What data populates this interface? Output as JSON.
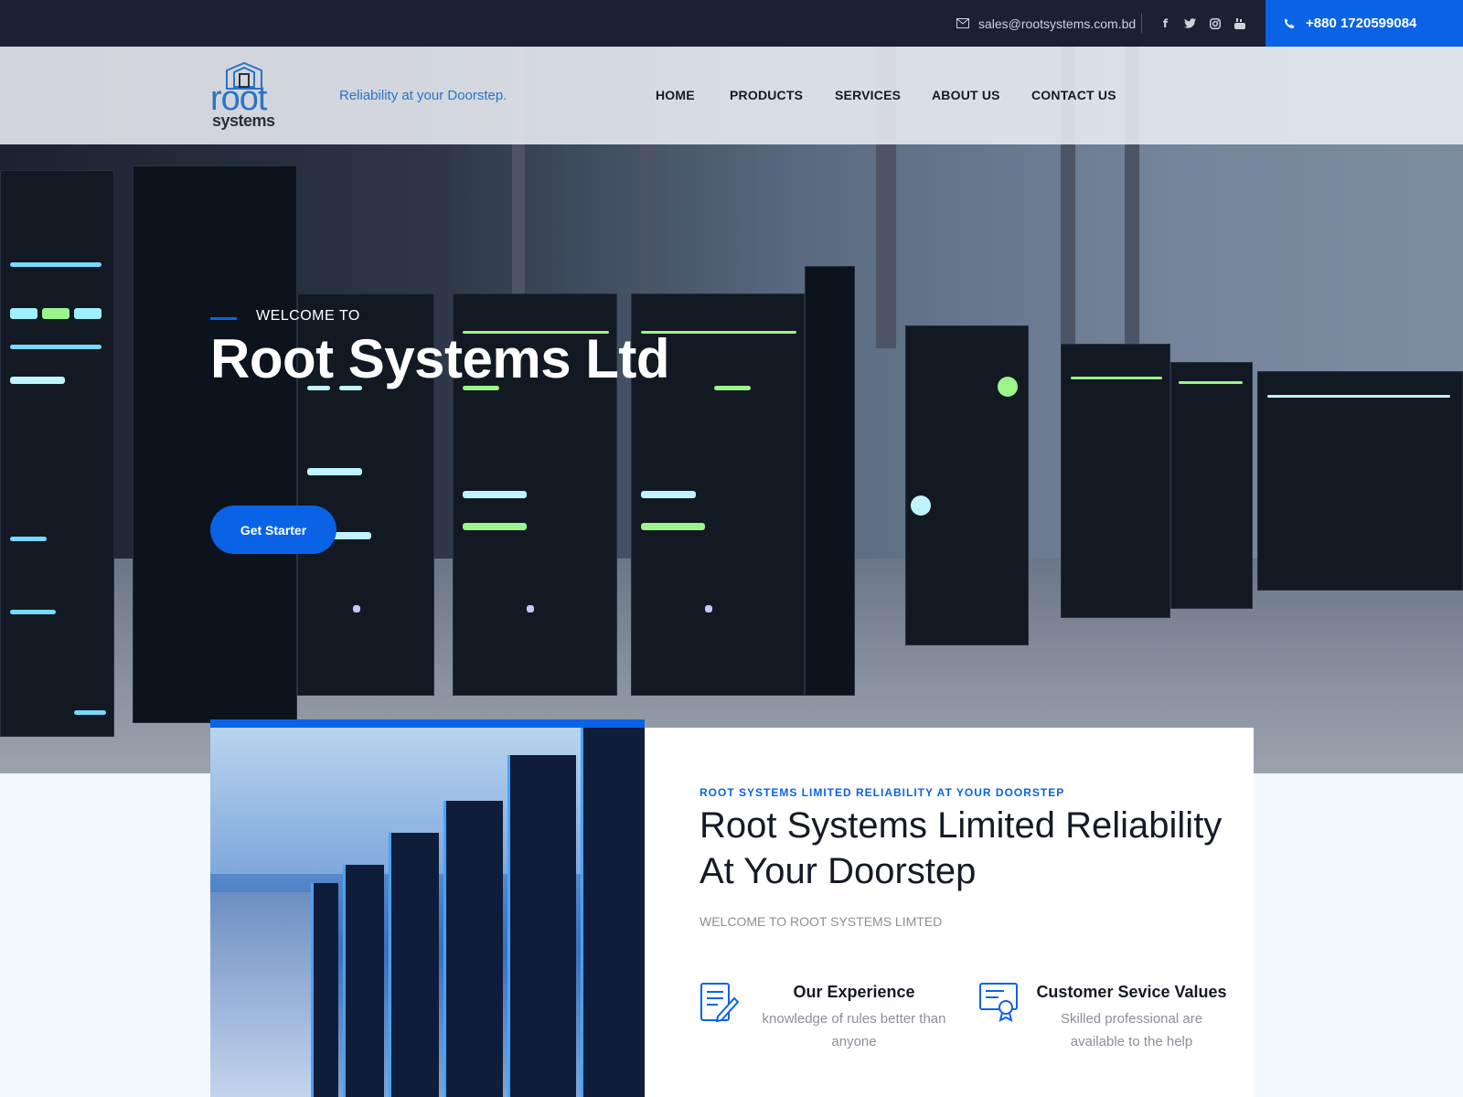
{
  "topbar": {
    "email": "sales@rootsystems.com.bd",
    "phone": "+880 1720599084",
    "social": [
      "facebook-icon",
      "twitter-icon",
      "instagram-icon",
      "youtube-icon"
    ]
  },
  "header": {
    "logo_text_top": "root",
    "logo_text_bottom": "systems",
    "tagline": "Reliability at your Doorstep.",
    "nav": [
      "HOME",
      "PRODUCTS",
      "SERVICES",
      "ABOUT US",
      "CONTACT US"
    ]
  },
  "hero": {
    "welcome": "WELCOME TO",
    "title": "Root Systems Ltd",
    "cta": "Get Starter"
  },
  "about": {
    "kicker": "ROOT SYSTEMS LIMITED RELIABILITY AT YOUR DOORSTEP",
    "title": "Root Systems Limited Reliability At Your Doorstep",
    "subtitle": "WELCOME TO ROOT SYSTEMS LIMTED",
    "features": [
      {
        "title": "Our Experience",
        "desc": "knowledge of rules better than anyone",
        "icon": "document-edit-icon"
      },
      {
        "title": "Customer Sevice Values",
        "desc": "Skilled professional are available to the help",
        "icon": "certificate-icon"
      }
    ]
  },
  "colors": {
    "accent": "#0a63e6",
    "topbar": "#1b2133",
    "text": "#151a26",
    "muted": "#8b8f99"
  }
}
